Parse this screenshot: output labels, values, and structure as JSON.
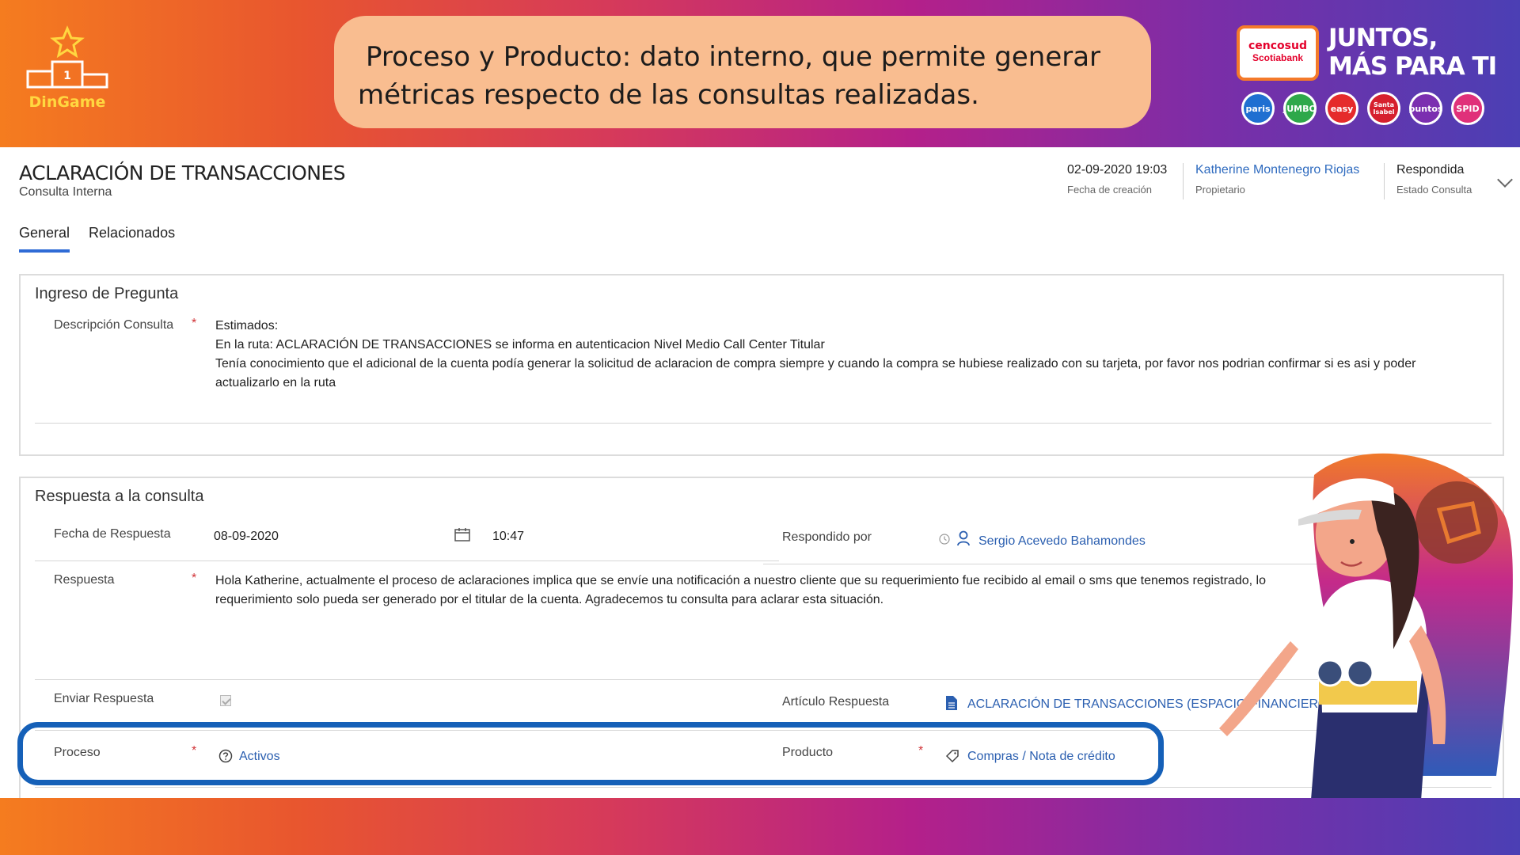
{
  "banner": {
    "logo_text": "DinGame",
    "podium_number": "1",
    "note_line1": "Proceso y Producto: dato interno, que permite generar",
    "note_line2": "métricas respecto de las consultas realizadas.",
    "brand_card_line1": "cencosud",
    "brand_card_line2": "Scotiabank",
    "slogan_line1": "JUNTOS,",
    "slogan_line2": "MÁS PARA TI",
    "stores": [
      "paris",
      "JUMBO",
      "easy",
      "Santa Isabel",
      "puntos",
      "SPID"
    ]
  },
  "colors": {
    "accent_blue": "#2f6bd6",
    "link_blue": "#2b5fb0",
    "required_red": "#d13438",
    "highlight_blue": "#1560b8",
    "note_bg": "#f9bd90"
  },
  "record": {
    "title": "ACLARACIÓN DE TRANSACCIONES",
    "subtitle": "Consulta Interna",
    "created_value": "02-09-2020 19:03",
    "created_label": "Fecha de creación",
    "owner_value": "Katherine Montenegro Riojas",
    "owner_label": "Propietario",
    "status_value": "Respondida",
    "status_label": "Estado Consulta"
  },
  "tabs": {
    "general": "General",
    "related": "Relacionados"
  },
  "question_section": {
    "title": "Ingreso de Pregunta",
    "desc_label": "Descripción Consulta",
    "required_mark": "*",
    "desc_line1": "Estimados:",
    "desc_line2": "En la ruta: ACLARACIÓN DE TRANSACCIONES se informa en autenticacion Nivel Medio Call Center Titular",
    "desc_line3": "Tenía conocimiento que el adicional de la cuenta podía generar la solicitud de aclaracion de compra siempre y cuando la compra se hubiese realizado con su tarjeta, por favor nos podrian confirmar si es asi y poder",
    "desc_line4": "actualizarlo en la ruta"
  },
  "answer_section": {
    "title": "Respuesta a la consulta",
    "date_label": "Fecha de Respuesta",
    "date_value": "08-09-2020",
    "time_value": "10:47",
    "answered_by_label": "Respondido por",
    "answered_by_value": "Sergio Acevedo Bahamondes",
    "answer_label": "Respuesta",
    "required_mark": "*",
    "answer_line1": "Hola Katherine, actualmente el proceso de aclaraciones implica que se envíe una notificación a nuestro cliente que su requerimiento fue recibido al email o sms que tenemos registrado, lo",
    "answer_line2": "requerimiento solo pueda ser generado por el titular de la cuenta. Agradecemos tu consulta para aclarar esta situación.",
    "send_label": "Enviar Respuesta",
    "article_label": "Artículo Respuesta",
    "article_value": "ACLARACIÓN DE TRANSACCIONES (ESPACIO FINANCIERO",
    "process_label": "Proceso",
    "process_value": "Activos",
    "product_label": "Producto",
    "product_value": "Compras / Nota de crédito"
  }
}
